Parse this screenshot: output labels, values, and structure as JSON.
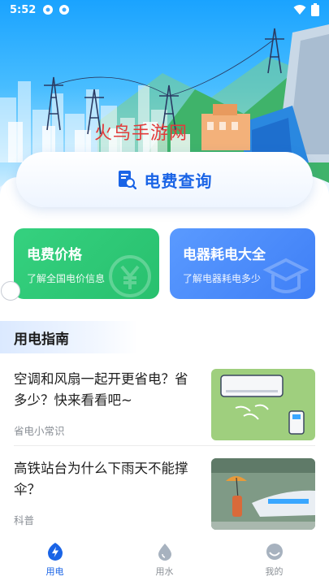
{
  "status_bar": {
    "time": "5:52"
  },
  "hero": {
    "watermark": "火鸟手游网"
  },
  "query_card": {
    "label": "电费查询"
  },
  "tiles": [
    {
      "title": "电费价格",
      "subtitle": "了解全国电价信息"
    },
    {
      "title": "电器耗电大全",
      "subtitle": "了解电器耗电多少"
    }
  ],
  "guide": {
    "section_title": "用电指南",
    "articles": [
      {
        "title": "空调和风扇一起开更省电？省多少？快来看看吧~",
        "tag": "省电小常识"
      },
      {
        "title": "高铁站台为什么下雨天不能撑伞？",
        "tag": "科普"
      }
    ]
  },
  "tabbar": {
    "items": [
      "用电",
      "用水",
      "我的"
    ],
    "active_index": 0
  },
  "colors": {
    "accent": "#1a64e6",
    "green_tile": "#2ec874",
    "blue_tile": "#4a8bfb"
  }
}
